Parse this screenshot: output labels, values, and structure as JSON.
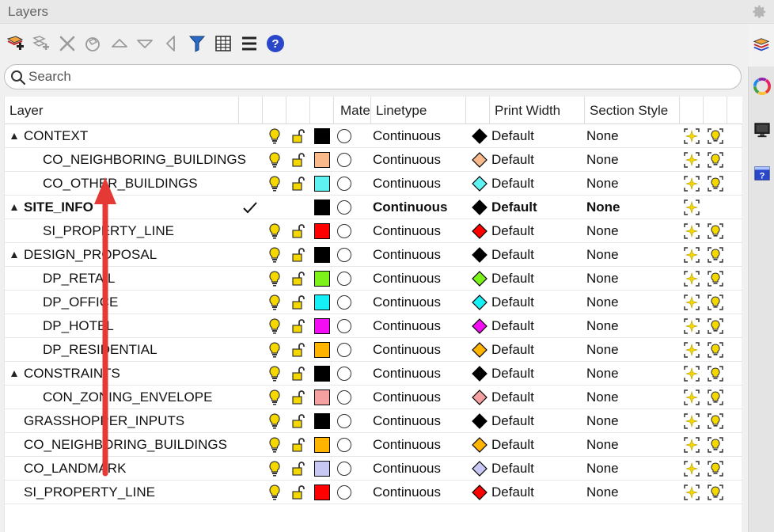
{
  "panel": {
    "title": "Layers"
  },
  "search": {
    "placeholder": "Search",
    "value": ""
  },
  "columns": {
    "layer": "Layer",
    "material": "Mate",
    "linetype": "Linetype",
    "print_width": "Print Width",
    "section_style": "Section Style"
  },
  "rows": [
    {
      "name": "CONTEXT",
      "level": 0,
      "expanded": true,
      "bold": false,
      "current": false,
      "color": "#000000",
      "linetype": "Continuous",
      "print_color": "#000000",
      "print_width": "Default",
      "section_style": "None"
    },
    {
      "name": "CO_NEIGHBORING_BUILDINGS",
      "level": 1,
      "expanded": null,
      "bold": false,
      "current": false,
      "color": "#f9b98a",
      "linetype": "Continuous",
      "print_color": "#f9b98a",
      "print_width": "Default",
      "section_style": "None"
    },
    {
      "name": "CO_OTHER_BUILDINGS",
      "level": 1,
      "expanded": null,
      "bold": false,
      "current": false,
      "color": "#5ef2f2",
      "linetype": "Continuous",
      "print_color": "#5ef2f2",
      "print_width": "Default",
      "section_style": "None"
    },
    {
      "name": "SITE_INFO",
      "level": 0,
      "expanded": true,
      "bold": true,
      "current": true,
      "color": "#000000",
      "linetype": "Continuous",
      "print_color": "#000000",
      "print_width": "Default",
      "section_style": "None"
    },
    {
      "name": "SI_PROPERTY_LINE",
      "level": 1,
      "expanded": null,
      "bold": false,
      "current": false,
      "color": "#ff0000",
      "linetype": "Continuous",
      "print_color": "#ff0000",
      "print_width": "Default",
      "section_style": "None"
    },
    {
      "name": "DESIGN_PROPOSAL",
      "level": 0,
      "expanded": true,
      "bold": false,
      "current": false,
      "color": "#000000",
      "linetype": "Continuous",
      "print_color": "#000000",
      "print_width": "Default",
      "section_style": "None"
    },
    {
      "name": "DP_RETAIL",
      "level": 1,
      "expanded": null,
      "bold": false,
      "current": false,
      "color": "#7cf21a",
      "linetype": "Continuous",
      "print_color": "#7cf21a",
      "print_width": "Default",
      "section_style": "None"
    },
    {
      "name": "DP_OFFICE",
      "level": 1,
      "expanded": null,
      "bold": false,
      "current": false,
      "color": "#14f0f5",
      "linetype": "Continuous",
      "print_color": "#14f0f5",
      "print_width": "Default",
      "section_style": "None"
    },
    {
      "name": "DP_HOTEL",
      "level": 1,
      "expanded": null,
      "bold": false,
      "current": false,
      "color": "#f20df2",
      "linetype": "Continuous",
      "print_color": "#f20df2",
      "print_width": "Default",
      "section_style": "None"
    },
    {
      "name": "DP_RESIDENTIAL",
      "level": 1,
      "expanded": null,
      "bold": false,
      "current": false,
      "color": "#ffb400",
      "linetype": "Continuous",
      "print_color": "#ffb400",
      "print_width": "Default",
      "section_style": "None"
    },
    {
      "name": "CONSTRAINTS",
      "level": 0,
      "expanded": true,
      "bold": false,
      "current": false,
      "color": "#000000",
      "linetype": "Continuous",
      "print_color": "#000000",
      "print_width": "Default",
      "section_style": "None"
    },
    {
      "name": "CON_ZONING_ENVELOPE",
      "level": 1,
      "expanded": null,
      "bold": false,
      "current": false,
      "color": "#f5a0a0",
      "linetype": "Continuous",
      "print_color": "#f5a0a0",
      "print_width": "Default",
      "section_style": "None"
    },
    {
      "name": "GRASSHOPPER_INPUTS",
      "level": 0,
      "expanded": null,
      "bold": false,
      "current": false,
      "color": "#000000",
      "linetype": "Continuous",
      "print_color": "#000000",
      "print_width": "Default",
      "section_style": "None"
    },
    {
      "name": "CO_NEIGHBORING_BUILDINGS",
      "level": 0,
      "expanded": null,
      "bold": false,
      "current": false,
      "color": "#ffb400",
      "linetype": "Continuous",
      "print_color": "#ffb400",
      "print_width": "Default",
      "section_style": "None"
    },
    {
      "name": "CO_LANDMARK",
      "level": 0,
      "expanded": null,
      "bold": false,
      "current": false,
      "color": "#c8c8f5",
      "linetype": "Continuous",
      "print_color": "#c8c8f5",
      "print_width": "Default",
      "section_style": "None"
    },
    {
      "name": "SI_PROPERTY_LINE",
      "level": 0,
      "expanded": null,
      "bold": false,
      "current": false,
      "color": "#ff0000",
      "linetype": "Continuous",
      "print_color": "#ff0000",
      "print_width": "Default",
      "section_style": "None"
    }
  ],
  "colors": {
    "annotation_arrow": "#e53935",
    "bulb": "#f5d800",
    "lock": "#f5d800",
    "help": "#2a47c9",
    "filter": "#1f5fb0"
  },
  "toolbar_icons": [
    "new-layer-icon",
    "new-sublayer-icon",
    "delete-icon",
    "filter-shape-icon",
    "move-up-icon",
    "move-down-icon",
    "move-out-icon",
    "filter-icon",
    "columns-icon",
    "menu-icon",
    "help-icon"
  ],
  "side_tabs": [
    "layers-tab-icon",
    "color-wheel-icon",
    "display-icon",
    "help-panel-icon"
  ]
}
